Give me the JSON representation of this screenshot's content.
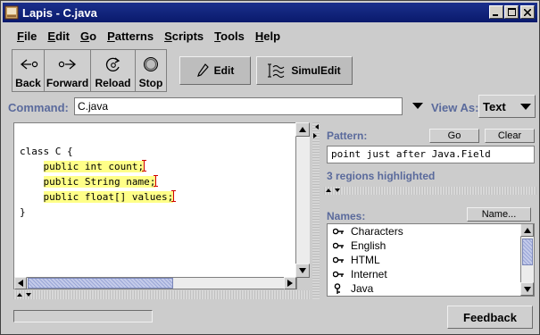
{
  "window": {
    "title": "Lapis - C.java",
    "controls": [
      "_",
      "□",
      "×"
    ]
  },
  "menubar": [
    {
      "label": "File"
    },
    {
      "label": "Edit"
    },
    {
      "label": "Go"
    },
    {
      "label": "Patterns"
    },
    {
      "label": "Scripts"
    },
    {
      "label": "Tools"
    },
    {
      "label": "Help"
    }
  ],
  "toolbar": {
    "back_label": "Back",
    "forward_label": "Forward",
    "reload_label": "Reload",
    "stop_label": "Stop",
    "edit_label": "Edit",
    "simuledit_label": "SimulEdit"
  },
  "command": {
    "label": "Command:",
    "value": "C.java",
    "view_as_label": "View As:",
    "view_as_value": "Text"
  },
  "editor": {
    "lines": [
      "class C {",
      "    public int count;",
      "    public String name;",
      "    public float[] values;",
      "}"
    ],
    "highlighted": [
      "public int count;",
      "public String name;",
      "public float[] values;"
    ]
  },
  "pattern": {
    "label": "Pattern:",
    "go_label": "Go",
    "clear_label": "Clear",
    "value": "point just after Java.Field",
    "status": "3 regions highlighted"
  },
  "names": {
    "label": "Names:",
    "button_label": "Name...",
    "items": [
      "Characters",
      "English",
      "HTML",
      "Internet",
      "Java"
    ]
  },
  "status": {
    "feedback_label": "Feedback",
    "progress": 0
  },
  "colors": {
    "titlebar": "#0a1a6c",
    "highlight": "#ffff88",
    "label_blue": "#5a6a9c",
    "caret_red": "#d00000"
  }
}
